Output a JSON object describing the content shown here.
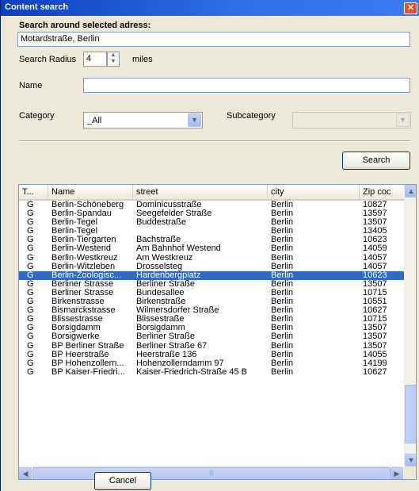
{
  "window": {
    "title": "Content search",
    "close_label": "✕"
  },
  "form": {
    "section_label": "Search around selected adress:",
    "address_value": "Motardstraße, Berlin",
    "radius_label": "Search Radius",
    "radius_value": "4",
    "radius_unit": "miles",
    "name_label": "Name",
    "name_value": "",
    "category_label": "Category",
    "category_value": "_All",
    "subcategory_label": "Subcategory",
    "subcategory_value": "",
    "search_label": "Search"
  },
  "list": {
    "columns": [
      "T...",
      "Name",
      "street",
      "city",
      "Zip coc"
    ],
    "selected_index": 8,
    "rows": [
      [
        "G",
        "Berlin-Schöneberg",
        "Dominicusstraße",
        "Berlin",
        "10827"
      ],
      [
        "G",
        "Berlin-Spandau",
        "Seegefelder Straße",
        "Berlin",
        "13597"
      ],
      [
        "G",
        "Berlin-Tegel",
        "Buddestraße",
        "Berlin",
        "13507"
      ],
      [
        "G",
        "Berlin-Tegel",
        "",
        "Berlin",
        "13405"
      ],
      [
        "G",
        "Berlin-Tiergarten",
        "Bachstraße",
        "Berlin",
        "10623"
      ],
      [
        "G",
        "Berlin-Westend",
        "Am Bahnhof Westend",
        "Berlin",
        "14059"
      ],
      [
        "G",
        "Berlin-Westkreuz",
        "Am Westkreuz",
        "Berlin",
        "14057"
      ],
      [
        "G",
        "Berlin-Witzleben",
        "Drosselsteg",
        "Berlin",
        "14057"
      ],
      [
        "G",
        "Berlin-Zoologisc...",
        "Hardenbergplatz",
        "Berlin",
        "10623"
      ],
      [
        "G",
        "Berliner Strasse",
        "Berliner Straße",
        "Berlin",
        "13507"
      ],
      [
        "G",
        "Berliner Strasse",
        "Bundesallee",
        "Berlin",
        "10715"
      ],
      [
        "G",
        "Birkenstrasse",
        "Birkenstraße",
        "Berlin",
        "10551"
      ],
      [
        "G",
        "Bismarckstrasse",
        "Wilmersdorfer Straße",
        "Berlin",
        "10627"
      ],
      [
        "G",
        "Blissestrasse",
        "Blissestraße",
        "Berlin",
        "10715"
      ],
      [
        "G",
        "Borsigdamm",
        "Borsigdamm",
        "Berlin",
        "13507"
      ],
      [
        "G",
        "Borsigwerke",
        "Berliner Straße",
        "Berlin",
        "13507"
      ],
      [
        "G",
        "BP Berliner Straße",
        "Berliner Straße 67",
        "Berlin",
        "13507"
      ],
      [
        "G",
        "BP Heerstraße",
        "Heerstraße 136",
        "Berlin",
        "14055"
      ],
      [
        "G",
        "BP Hohenzollern...",
        "Hohenzollerndamm 97",
        "Berlin",
        "14199"
      ],
      [
        "G",
        "BP Kaiser-Friedri...",
        "Kaiser-Friedrich-Straße 45 B",
        "Berlin",
        "10627"
      ]
    ]
  },
  "footer": {
    "cancel_label": "Cancel"
  },
  "colors": {
    "titlebar": "#0a3fbf",
    "selection": "#316ac5",
    "dialog_bg": "#ece9d8"
  },
  "icons": {
    "close": "close-icon",
    "spin_up": "spin-up-icon",
    "spin_down": "spin-down-icon",
    "dropdown": "chevron-down-icon",
    "scroll_up": "scroll-up-icon",
    "scroll_down": "scroll-down-icon",
    "scroll_left": "scroll-left-icon",
    "scroll_right": "scroll-right-icon"
  }
}
